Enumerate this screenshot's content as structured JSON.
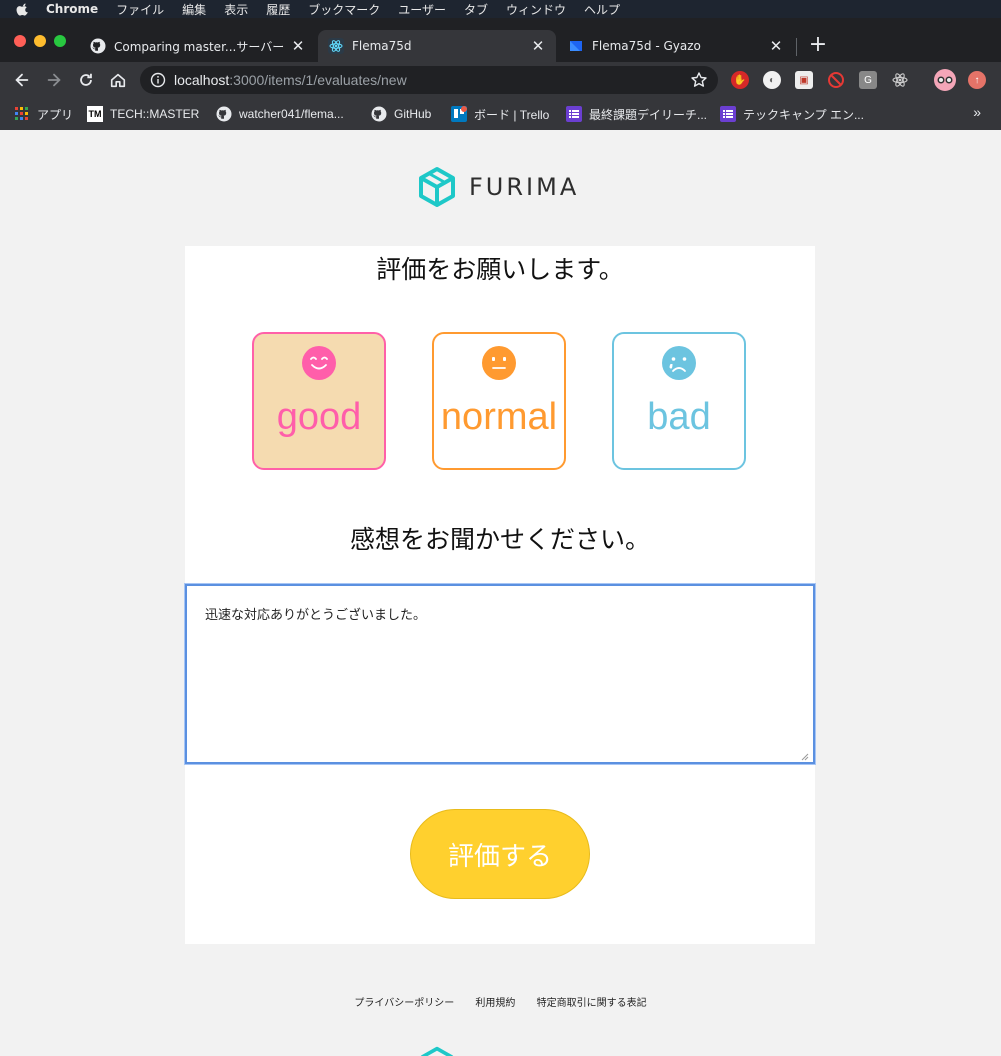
{
  "menubar": {
    "app": "Chrome",
    "items": [
      "ファイル",
      "編集",
      "表示",
      "履歴",
      "ブックマーク",
      "ユーザー",
      "タブ",
      "ウィンドウ",
      "ヘルプ"
    ]
  },
  "tabs": [
    {
      "title": "Comparing master...サーバー",
      "icon": "github-icon",
      "active": false
    },
    {
      "title": "Flema75d",
      "icon": "react-icon",
      "active": true
    },
    {
      "title": "Flema75d - Gyazo",
      "icon": "gyazo-icon",
      "active": false
    }
  ],
  "address": {
    "host": "localhost",
    "path": ":3000/items/1/evaluates/new"
  },
  "bookmarks": [
    {
      "label": "アプリ",
      "icon": "apps-grid-icon"
    },
    {
      "label": "TECH::MASTER",
      "icon": "techmaster-icon"
    },
    {
      "label": "watcher041/flema...",
      "icon": "github-icon"
    },
    {
      "label": "GitHub",
      "icon": "github-icon"
    },
    {
      "label": "ボード | Trello",
      "icon": "trello-icon"
    },
    {
      "label": "最終課題デイリーチ...",
      "icon": "list-icon"
    },
    {
      "label": "テックキャンプ エン...",
      "icon": "list-icon"
    }
  ],
  "page": {
    "logo_text": "FURIMA",
    "heading_rating": "評価をお願いします。",
    "ratings": [
      {
        "label": "good",
        "selected": true
      },
      {
        "label": "normal",
        "selected": false
      },
      {
        "label": "bad",
        "selected": false
      }
    ],
    "heading_comment": "感想をお聞かせください。",
    "comment_value": "迅速な対応ありがとうございました。",
    "submit_label": "評価する",
    "footer_links": [
      "プライバシーポリシー",
      "利用規約",
      "特定商取引に関する表記"
    ]
  },
  "colors": {
    "good": "#ff5eaa",
    "normal": "#ff9a30",
    "bad": "#6cc4e0",
    "submit": "#ffd02e",
    "logo": "#1ec8c8"
  }
}
